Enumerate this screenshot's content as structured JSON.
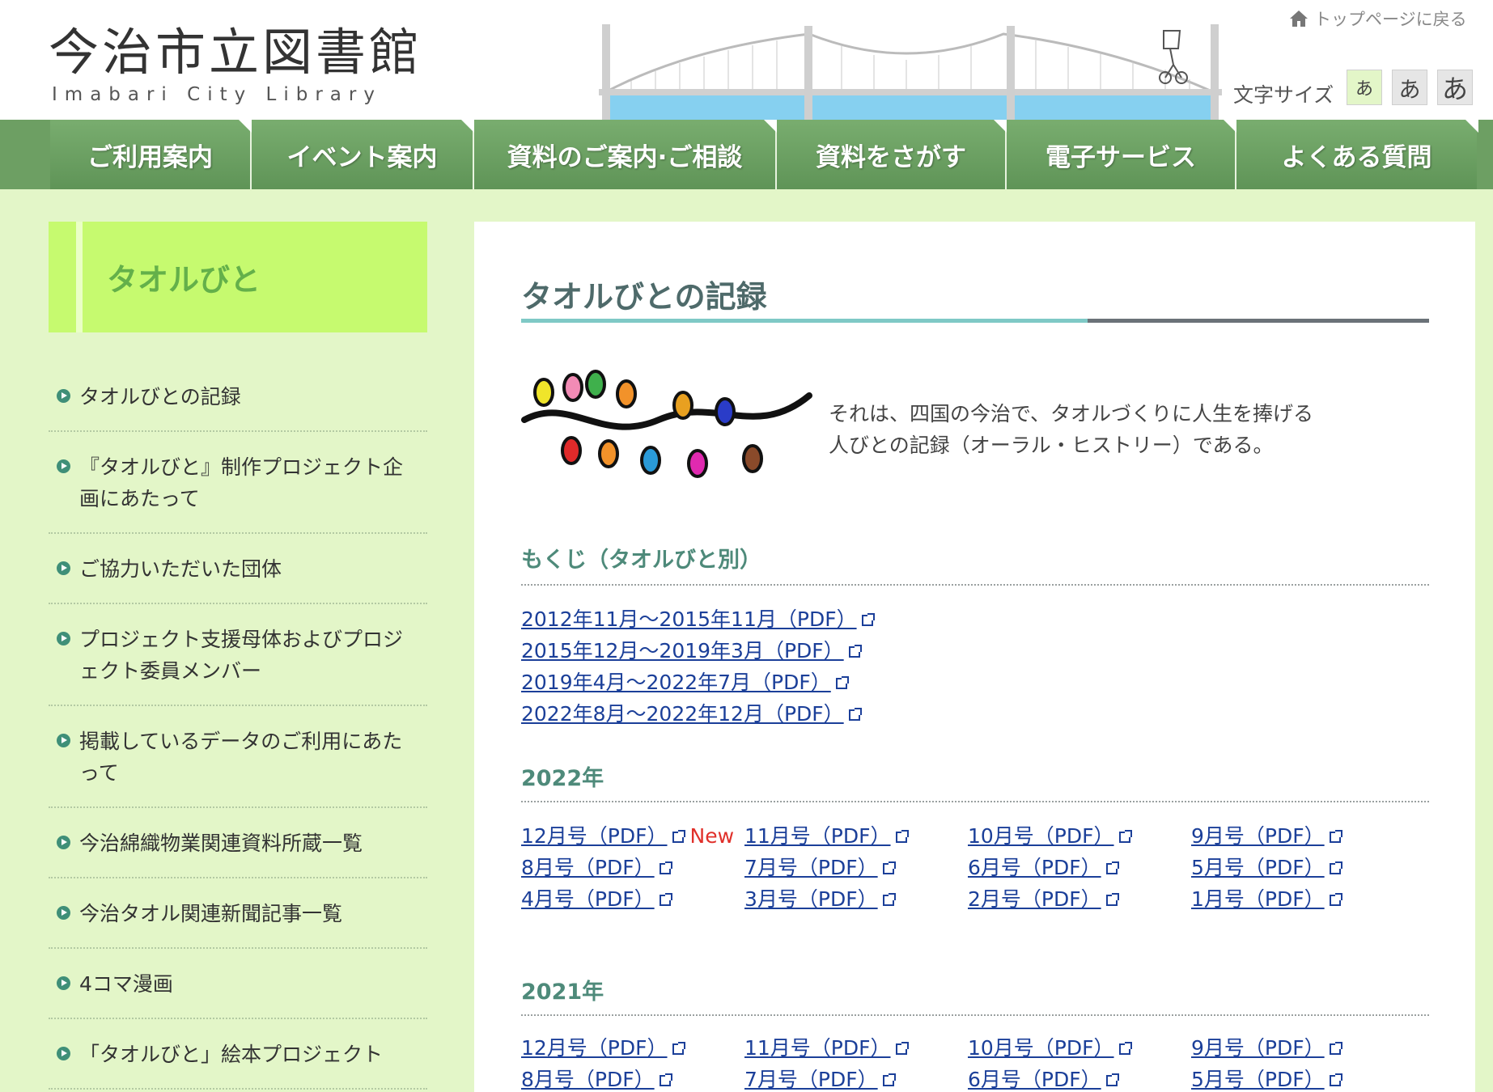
{
  "header": {
    "logo_jp": "今治市立図書館",
    "logo_en": "Imabari City Library",
    "top_link": "トップページに戻る",
    "font_size_label": "文字サイズ",
    "font_size_options": [
      "あ",
      "あ",
      "あ"
    ]
  },
  "nav": {
    "items": [
      "ご利用案内",
      "イベント案内",
      "資料のご案内·ご相談",
      "資料をさがす",
      "電子サービス",
      "よくある質問"
    ]
  },
  "sidebar": {
    "title": "タオルびと",
    "items": [
      "タオルびとの記録",
      "『タオルびと』制作プロジェクト企画にあたって",
      "ご協力いただいた団体",
      "プロジェクト支援母体およびプロジェクト委員メンバー",
      "掲載しているデータのご利用にあたって",
      "今治綿織物業関連資料所蔵一覧",
      "今治タオル関連新聞記事一覧",
      "4コマ漫画",
      "「タオルびと」絵本プロジェクト"
    ]
  },
  "main": {
    "title": "タオルびとの記録",
    "intro_line1": "それは、四国の今治で、タオルづくりに人生を捧げる",
    "intro_line2": "人びとの記録（オーラル・ヒストリー）である。",
    "toc_heading": "もくじ（タオルびと別）",
    "toc_links": [
      "2012年11月～2015年11月（PDF）",
      "2015年12月～2019年3月（PDF）",
      "2019年4月～2022年7月（PDF）",
      "2022年8月～2022年12月（PDF）"
    ],
    "new_label": "New",
    "years": [
      {
        "year": "2022年",
        "links": [
          "12月号（PDF）",
          "11月号（PDF）",
          "10月号（PDF）",
          "9月号（PDF）",
          "8月号（PDF）",
          "7月号（PDF）",
          "6月号（PDF）",
          "5月号（PDF）",
          "4月号（PDF）",
          "3月号（PDF）",
          "2月号（PDF）",
          "1月号（PDF）"
        ]
      },
      {
        "year": "2021年",
        "links": [
          "12月号（PDF）",
          "11月号（PDF）",
          "10月号（PDF）",
          "9月号（PDF）",
          "8月号（PDF）",
          "7月号（PDF）",
          "6月号（PDF）",
          "5月号（PDF）"
        ]
      }
    ]
  },
  "colors": {
    "nav_green": "#6d9f63",
    "page_bg": "#e3f6c8",
    "sidebar_title_bg": "#c6fa6f",
    "link": "#1b3f99",
    "new_badge": "#e0302a"
  }
}
